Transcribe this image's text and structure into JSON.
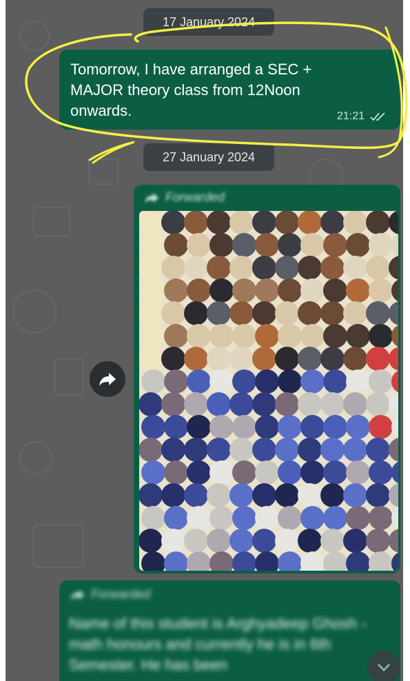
{
  "dates": {
    "first": "17 January 2024",
    "second": "27 January 2024"
  },
  "message1": {
    "text": "Tomorrow, I have arranged a SEC + MAJOR theory class from 12Noon onwards.",
    "time": "21:21",
    "status_icon": "double-check-icon"
  },
  "message2": {
    "forwarded_label": "Forwarded",
    "media": "image (pixelated/obscured)"
  },
  "message3": {
    "forwarded_label": "Forwarded",
    "text": "Name of this student is Arghyadeep Ghosh - math honours and currently he is in 6th Semester. He has been"
  },
  "colors": {
    "wallpaper": "#5d5d5d",
    "bubble": "#0b5e44",
    "date_chip": "#3c4145",
    "highlight": "#f5ef45"
  },
  "icons": {
    "share": "forward-share-icon",
    "scroll": "chevron-down-icon",
    "forward": "forward-arrow-icon"
  }
}
